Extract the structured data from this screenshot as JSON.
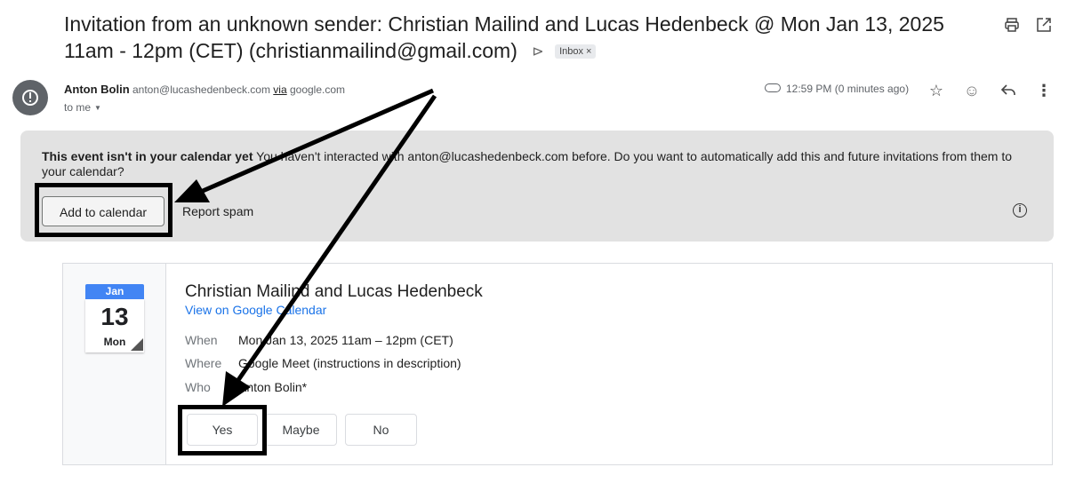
{
  "subject": {
    "text": "Invitation from an unknown sender: Christian Mailind and Lucas Hedenbeck @ Mon Jan 13, 2025 11am - 12pm (CET) (christianmailind@gmail.com)",
    "label": "Inbox",
    "label_close": "×"
  },
  "toolbar": {
    "print_icon": "print-icon",
    "open_new_window_icon": "open-in-new-icon"
  },
  "sender": {
    "name": "Anton Bolin",
    "email": "anton@lucashedenbeck.com",
    "via_label": "via",
    "via_domain": "google.com",
    "to": "to me",
    "time": "12:59 PM (0 minutes ago)"
  },
  "banner": {
    "title": "This event isn't in your calendar yet",
    "message": "You haven't interacted with anton@lucashedenbeck.com before. Do you want to automatically add this and future invitations from them to your calendar?",
    "add_button": "Add to calendar",
    "spam_button": "Report spam"
  },
  "event": {
    "month": "Jan",
    "day": "13",
    "weekday": "Mon",
    "title": "Christian Mailind and Lucas Hedenbeck",
    "view_link": "View on Google Calendar",
    "when_label": "When",
    "when_value": "Mon Jan 13, 2025 11am – 12pm (CET)",
    "where_label": "Where",
    "where_value": "Google Meet (instructions in description)",
    "who_label": "Who",
    "who_value": "Anton Bolin*",
    "rsvp": {
      "yes": "Yes",
      "maybe": "Maybe",
      "no": "No"
    }
  },
  "colors": {
    "accent_blue": "#1a73e8",
    "calendar_blue": "#4285f4",
    "banner_bg": "#e2e2e2",
    "annotation": "#000000"
  }
}
